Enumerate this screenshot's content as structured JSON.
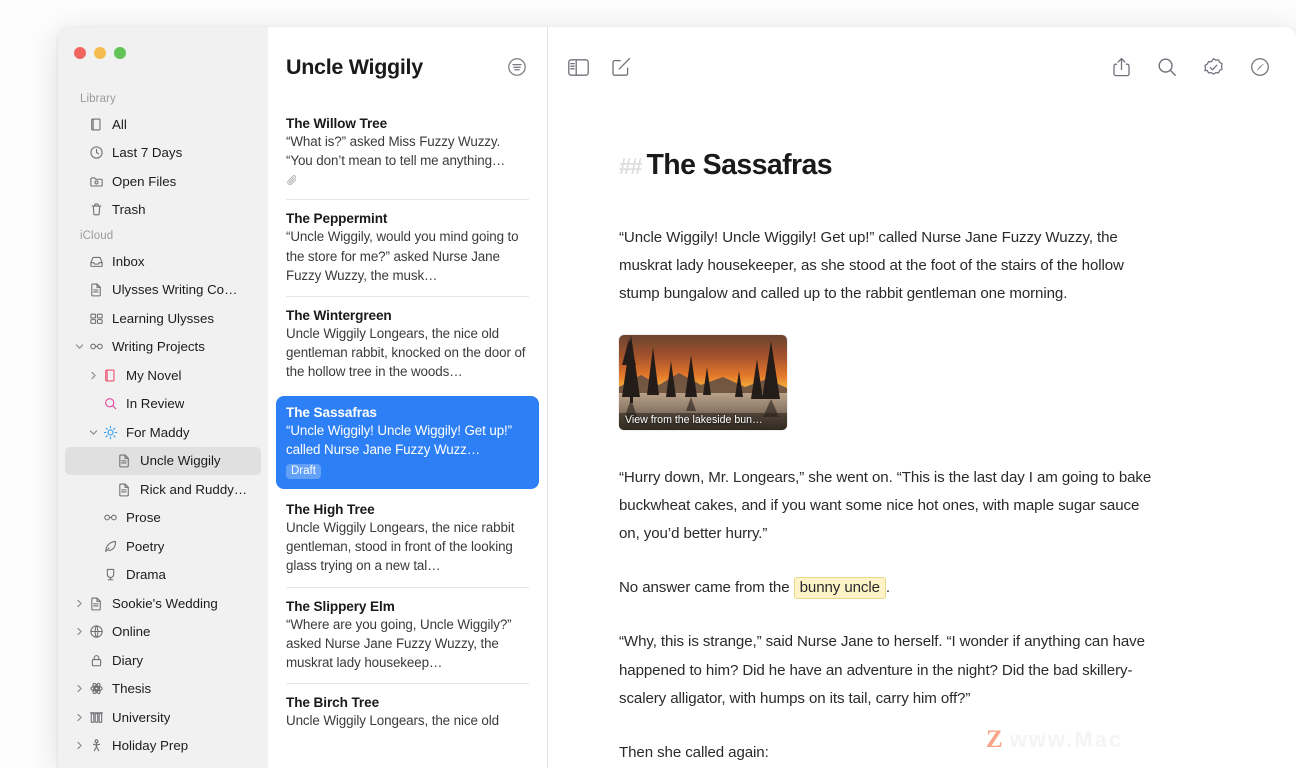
{
  "window": {
    "traffic_lights": [
      "close",
      "minimize",
      "zoom"
    ],
    "accent_color": "#2d7ff5",
    "highlight_color": "#fdf3c6"
  },
  "sidebar": {
    "groups": [
      {
        "label": "Library",
        "items": [
          {
            "label": "All",
            "icon": "books-icon",
            "level": 0,
            "disclosure": "none",
            "selected": false
          },
          {
            "label": "Last 7 Days",
            "icon": "clock-icon",
            "level": 0,
            "disclosure": "none",
            "selected": false
          },
          {
            "label": "Open Files",
            "icon": "open-folder-icon",
            "level": 0,
            "disclosure": "none",
            "selected": false
          },
          {
            "label": "Trash",
            "icon": "trash-icon",
            "level": 0,
            "disclosure": "none",
            "selected": false
          }
        ]
      },
      {
        "label": "iCloud",
        "items": [
          {
            "label": "Inbox",
            "icon": "inbox-icon",
            "level": 0,
            "disclosure": "none",
            "selected": false
          },
          {
            "label": "Ulysses Writing Co…",
            "icon": "document-icon",
            "level": 0,
            "disclosure": "none",
            "selected": false
          },
          {
            "label": "Learning Ulysses",
            "icon": "cards-icon",
            "level": 0,
            "disclosure": "none",
            "selected": false
          },
          {
            "label": "Writing Projects",
            "icon": "glasses-icon",
            "level": 0,
            "disclosure": "expanded",
            "selected": false
          },
          {
            "label": "My Novel",
            "icon": "red-book-icon",
            "level": 1,
            "disclosure": "collapsed",
            "selected": false
          },
          {
            "label": "In Review",
            "icon": "magnifier-pink-icon",
            "level": 1,
            "disclosure": "none",
            "selected": false
          },
          {
            "label": "For Maddy",
            "icon": "sun-blue-icon",
            "level": 1,
            "disclosure": "expanded",
            "selected": false
          },
          {
            "label": "Uncle Wiggily",
            "icon": "document-icon",
            "level": 2,
            "disclosure": "none",
            "selected": true
          },
          {
            "label": "Rick and Ruddy…",
            "icon": "document-icon",
            "level": 2,
            "disclosure": "none",
            "selected": false
          },
          {
            "label": "Prose",
            "icon": "glasses-icon",
            "level": 1,
            "disclosure": "none",
            "selected": false
          },
          {
            "label": "Poetry",
            "icon": "quill-icon",
            "level": 1,
            "disclosure": "none",
            "selected": false
          },
          {
            "label": "Drama",
            "icon": "mask-icon",
            "level": 1,
            "disclosure": "none",
            "selected": false
          },
          {
            "label": "Sookie's Wedding",
            "icon": "document-icon",
            "level": 0,
            "disclosure": "collapsed",
            "selected": false
          },
          {
            "label": "Online",
            "icon": "globe-icon",
            "level": 0,
            "disclosure": "collapsed",
            "selected": false
          },
          {
            "label": "Diary",
            "icon": "lock-icon",
            "level": 0,
            "disclosure": "none",
            "selected": false
          },
          {
            "label": "Thesis",
            "icon": "atom-icon",
            "level": 0,
            "disclosure": "collapsed",
            "selected": false
          },
          {
            "label": "University",
            "icon": "library-icon",
            "level": 0,
            "disclosure": "collapsed",
            "selected": false
          },
          {
            "label": "Holiday Prep",
            "icon": "person-icon",
            "level": 0,
            "disclosure": "collapsed",
            "selected": false
          }
        ]
      }
    ]
  },
  "notelist": {
    "title": "Uncle Wiggily",
    "filter_icon": "filter-circle-icon",
    "notes": [
      {
        "title": "The Willow Tree",
        "snippet": "“What is?” asked Miss Fuzzy Wuzzy. “You don’t mean to tell me anything…",
        "badge": "",
        "attachment": true,
        "selected": false
      },
      {
        "title": "The Peppermint",
        "snippet": "“Uncle Wiggily, would you mind going to the store for me?” asked Nurse Jane Fuzzy Wuzzy, the musk…",
        "badge": "",
        "attachment": false,
        "selected": false
      },
      {
        "title": "The Wintergreen",
        "snippet": "Uncle Wiggily Longears, the nice old gentleman rabbit, knocked on the door of the hollow tree in the woods…",
        "badge": "",
        "attachment": false,
        "selected": false
      },
      {
        "title": "The Sassafras",
        "snippet": "“Uncle Wiggily! Uncle Wiggily! Get up!” called Nurse Jane Fuzzy Wuzz…",
        "badge": "Draft",
        "attachment": false,
        "selected": true
      },
      {
        "title": "The High Tree",
        "snippet": "Uncle Wiggily Longears, the nice rabbit gentleman, stood in front of the looking glass trying on a new tal…",
        "badge": "",
        "attachment": false,
        "selected": false
      },
      {
        "title": "The Slippery Elm",
        "snippet": "“Where are you going, Uncle Wiggily?” asked Nurse Jane Fuzzy Wuzzy, the muskrat lady housekeep…",
        "badge": "",
        "attachment": false,
        "selected": false
      },
      {
        "title": "The Birch Tree",
        "snippet": "Uncle Wiggily Longears, the nice old",
        "badge": "",
        "attachment": false,
        "selected": false
      }
    ]
  },
  "editor": {
    "toolbar_left": [
      {
        "name": "toggle-sidebar-icon",
        "label": "Toggle Sidebar"
      },
      {
        "name": "compose-icon",
        "label": "New Sheet"
      }
    ],
    "toolbar_right": [
      {
        "name": "share-icon",
        "label": "Share"
      },
      {
        "name": "search-icon",
        "label": "Search"
      },
      {
        "name": "check-badge-icon",
        "label": "Revision"
      },
      {
        "name": "info-circle-icon",
        "label": "Statistics"
      }
    ],
    "markdown_marker": "##",
    "title": "The Sassafras",
    "paragraphs": [
      "“Uncle Wiggily! Uncle Wiggily! Get up!” called Nurse Jane Fuzzy Wuzzy, the muskrat lady housekeeper, as she stood at the foot of the stairs of the hollow stump bungalow and called up to the rabbit gentleman one morning.",
      "“Hurry down, Mr. Longears,” she went on. “This is the last day I am going to bake buckwheat cakes, and if you want some nice hot ones, with maple sugar sauce on, you’d better hurry.”",
      "“Why, this is strange,” said Nurse Jane to herself. “I wonder if anything can have happened to him? Did he have an adventure in the night? Did the bad skillery-scalery alligator, with humps on its tail, carry him off?”",
      "Then she called again:"
    ],
    "highlight_paragraph": {
      "before": "No answer came from the ",
      "highlight": "bunny uncle",
      "after": "."
    },
    "image": {
      "caption": "View from the lakeside bun…",
      "alt": "sunset-lake-landscape"
    }
  },
  "watermark": {
    "mark": "Z",
    "text": "www.Mac"
  }
}
